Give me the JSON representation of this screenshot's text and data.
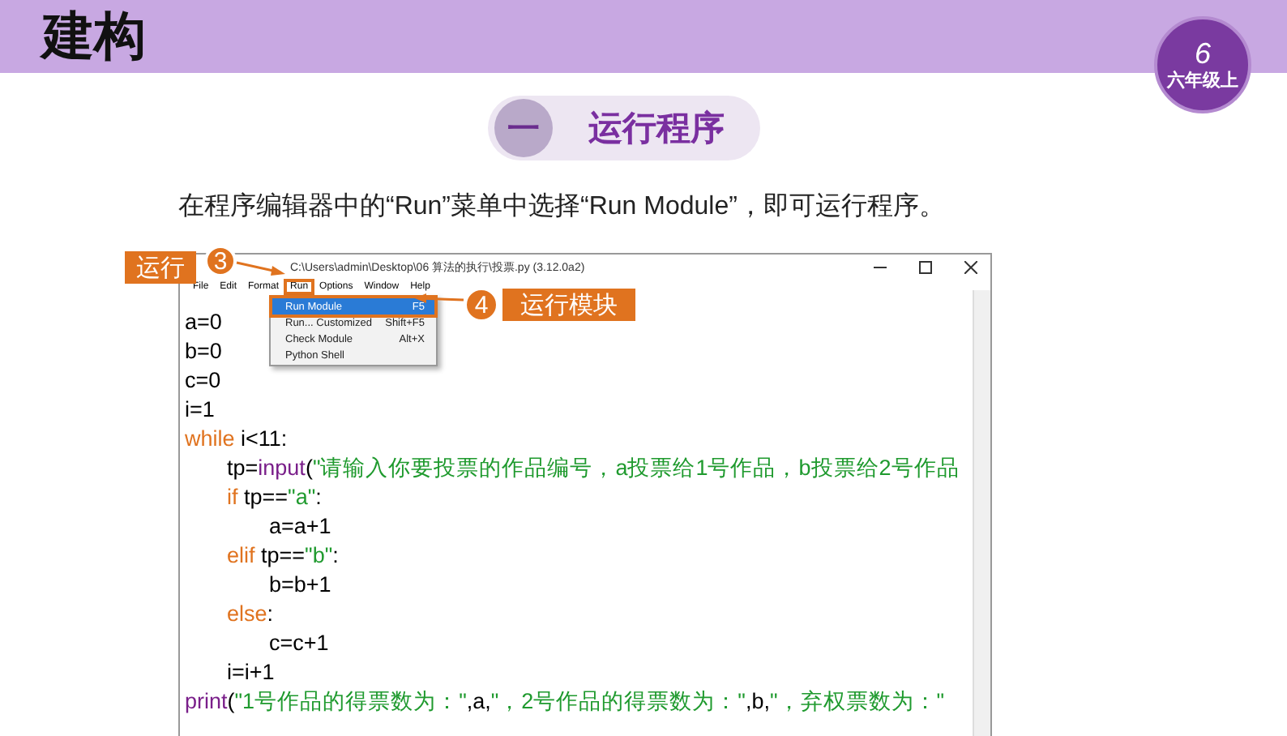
{
  "header": {
    "title": "建构",
    "grade_badge": {
      "number": "6",
      "label": "六年级上"
    }
  },
  "section": {
    "number": "一",
    "title": "运行程序"
  },
  "instruction": "在程序编辑器中的“Run”菜单中选择“Run Module”，即可运行程序。",
  "editor": {
    "title": "C:\\Users\\admin\\Desktop\\06 算法的执行\\投票.py (3.12.0a2)",
    "menu": [
      {
        "label": "File",
        "highlighted": false
      },
      {
        "label": "Edit",
        "highlighted": false
      },
      {
        "label": "Format",
        "highlighted": false
      },
      {
        "label": "Run",
        "highlighted": true
      },
      {
        "label": "Options",
        "highlighted": false
      },
      {
        "label": "Window",
        "highlighted": false
      },
      {
        "label": "Help",
        "highlighted": false
      }
    ],
    "dropdown": [
      {
        "label": "Run Module",
        "shortcut": "F5",
        "selected": true
      },
      {
        "label": "Run... Customized",
        "shortcut": "Shift+F5",
        "selected": false
      },
      {
        "label": "Check Module",
        "shortcut": "Alt+X",
        "selected": false
      },
      {
        "label": "Python Shell",
        "selected": false
      }
    ],
    "code": [
      {
        "tokens": [
          {
            "kind": "plain",
            "text": "a=0"
          }
        ]
      },
      {
        "tokens": [
          {
            "kind": "plain",
            "text": "b=0"
          }
        ]
      },
      {
        "tokens": [
          {
            "kind": "plain",
            "text": "c=0"
          }
        ]
      },
      {
        "tokens": [
          {
            "kind": "plain",
            "text": "i=1"
          }
        ]
      },
      {
        "tokens": [
          {
            "kind": "keyword",
            "text": "while"
          },
          {
            "kind": "plain",
            "text": " i<11:"
          }
        ],
        "children": [
          {
            "tokens": [
              {
                "kind": "plain",
                "text": "tp="
              },
              {
                "kind": "builtin",
                "text": "input"
              },
              {
                "kind": "plain",
                "text": "("
              },
              {
                "kind": "string",
                "text": "\"请输入你要投票的作品编号，a投票给1号作品，b投票给2号作品"
              }
            ]
          },
          {
            "tokens": [
              {
                "kind": "keyword",
                "text": "if"
              },
              {
                "kind": "plain",
                "text": " tp=="
              },
              {
                "kind": "string",
                "text": "\"a\""
              },
              {
                "kind": "plain",
                "text": ":"
              }
            ],
            "children": [
              {
                "tokens": [
                  {
                    "kind": "plain",
                    "text": "a=a+1"
                  }
                ]
              }
            ]
          },
          {
            "tokens": [
              {
                "kind": "keyword",
                "text": "elif"
              },
              {
                "kind": "plain",
                "text": " tp=="
              },
              {
                "kind": "string",
                "text": "\"b\""
              },
              {
                "kind": "plain",
                "text": ":"
              }
            ],
            "children": [
              {
                "tokens": [
                  {
                    "kind": "plain",
                    "text": "b=b+1"
                  }
                ]
              }
            ]
          },
          {
            "tokens": [
              {
                "kind": "keyword",
                "text": "else"
              },
              {
                "kind": "plain",
                "text": ":"
              }
            ],
            "children": [
              {
                "tokens": [
                  {
                    "kind": "plain",
                    "text": "c=c+1"
                  }
                ]
              }
            ]
          },
          {
            "tokens": [
              {
                "kind": "plain",
                "text": "i=i+1"
              }
            ]
          }
        ]
      },
      {
        "tokens": [
          {
            "kind": "builtin",
            "text": "print"
          },
          {
            "kind": "plain",
            "text": "("
          },
          {
            "kind": "string",
            "text": "\"1号作品的得票数为：\""
          },
          {
            "kind": "plain",
            "text": ",a,"
          },
          {
            "kind": "string",
            "text": "\"，2号作品的得票数为：\""
          },
          {
            "kind": "plain",
            "text": ",b,"
          },
          {
            "kind": "string",
            "text": "\"，弃权票数为：\""
          }
        ]
      }
    ]
  },
  "annotations": [
    {
      "number": "3",
      "label": "运行"
    },
    {
      "number": "4",
      "label": "运行模块"
    }
  ]
}
